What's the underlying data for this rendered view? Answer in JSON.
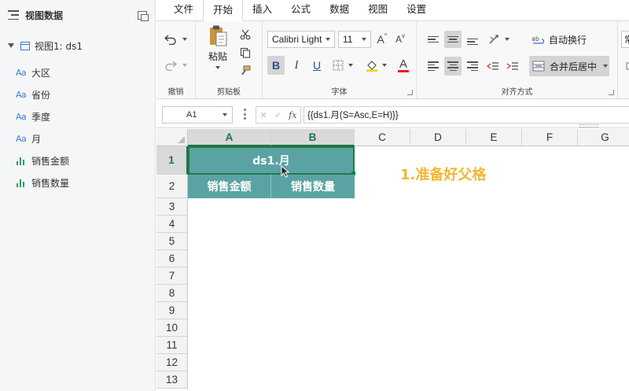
{
  "sidebar": {
    "title": "视图数据",
    "view": "视图1: ds1",
    "fields": [
      {
        "label": "大区",
        "type": "dimension",
        "icon_text": "Aa"
      },
      {
        "label": "省份",
        "type": "dimension",
        "icon_text": "Aa"
      },
      {
        "label": "季度",
        "type": "dimension",
        "icon_text": "Aa"
      },
      {
        "label": "月",
        "type": "dimension",
        "icon_text": "Aa"
      },
      {
        "label": "销售金额",
        "type": "measure",
        "icon": "bar-chart-icon"
      },
      {
        "label": "销售数量",
        "type": "measure",
        "icon": "bar-chart-icon"
      }
    ]
  },
  "tabs": [
    "文件",
    "开始",
    "插入",
    "公式",
    "数据",
    "视图",
    "设置"
  ],
  "active_tab": "开始",
  "ribbon": {
    "undo_group": "撤销",
    "clipboard_group": "剪贴板",
    "paste_label": "粘贴",
    "font_group": "字体",
    "font_name": "Calibri Light",
    "font_size": "11",
    "bold": "B",
    "italic": "I",
    "underline": "U",
    "font_color_glyph": "A",
    "grow_glyph": "A",
    "shrink_glyph": "A",
    "align_group": "对齐方式",
    "wrap_text": "自动换行",
    "merge_center": "合并后居中",
    "clipped_next": "常"
  },
  "formula_bar": {
    "name_box": "A1",
    "fx": "fx",
    "formula": "{{ds1.月(S=Asc,E=H)}}"
  },
  "sheet": {
    "columns": [
      "A",
      "B",
      "C",
      "D",
      "E",
      "F",
      "G"
    ],
    "rows": [
      "1",
      "2",
      "3",
      "4",
      "5",
      "6",
      "7",
      "8",
      "9",
      "10",
      "11",
      "12",
      "13"
    ],
    "a1_merged": "ds1.月",
    "a2": "销售金额",
    "b2": "销售数量",
    "annotation": "1.准备好父格"
  },
  "colors": {
    "cell_fill": "#5ba3a3",
    "selection": "#1f7a4c",
    "annotation": "#f2b731",
    "accent": "#3a7fd6"
  }
}
